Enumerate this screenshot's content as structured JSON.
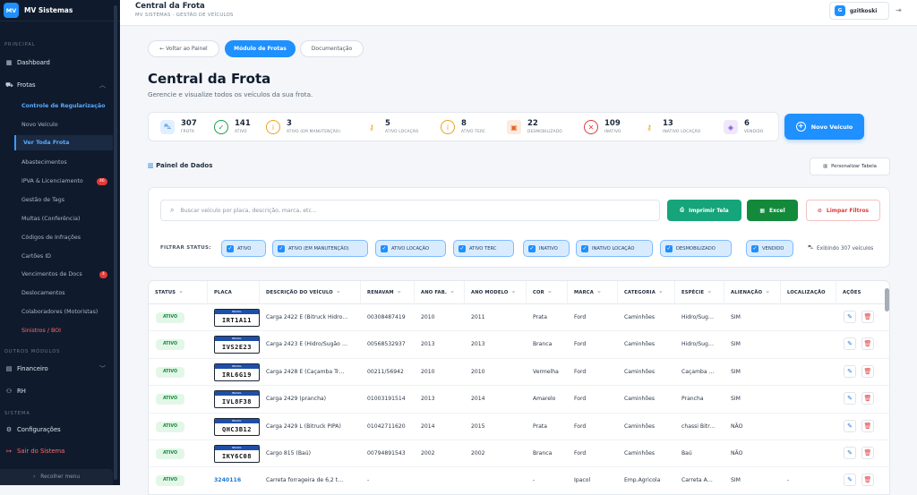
{
  "app": {
    "logo": "MV",
    "name": "MV Sistemas"
  },
  "sidebar": {
    "sections": {
      "principal": "PRINCIPAL",
      "outros": "OUTROS MÓDULOS",
      "sistema": "SISTEMA"
    },
    "dashboard": "Dashboard",
    "frotas": "Frotas",
    "frotas_items": [
      {
        "label": "Controle de Regularização"
      },
      {
        "label": "Novo Veículo"
      },
      {
        "label": "Ver Toda Frota"
      },
      {
        "label": "Abastecimentos"
      },
      {
        "label": "IPVA & Licenciamento",
        "badge": "46"
      },
      {
        "label": "Gestão de Tags"
      },
      {
        "label": "Multas (Conferência)"
      },
      {
        "label": "Códigos de Infrações"
      },
      {
        "label": "Cartões ID"
      },
      {
        "label": "Vencimentos de Docs",
        "badge": "4"
      },
      {
        "label": "Deslocamentos"
      },
      {
        "label": "Colaboradores (Motoristas)"
      },
      {
        "label": "Sinistros / BOI"
      }
    ],
    "financeiro": "Financeiro",
    "rh": "RH",
    "configuracoes": "Configurações",
    "sair": "Sair do Sistema",
    "recolher": "Recolher menu"
  },
  "topbar": {
    "title": "Central da Frota",
    "subtitle": "MV SISTEMAS - GESTÃO DE VEÍCULOS",
    "user_initial": "G",
    "user": "gzitkoski"
  },
  "tabs": {
    "back": "← Voltar ao Painel",
    "module": "Módulo de Frotas",
    "docs": "Documentação"
  },
  "page": {
    "title": "Central da Frota",
    "subtitle": "Gerencie e visualize todos os veículos da sua frota."
  },
  "stats": [
    {
      "value": "307",
      "label": "FROTA"
    },
    {
      "value": "141",
      "label": "ATIVO"
    },
    {
      "value": "3",
      "label": "ATIVO (EM MANUTENÇÃO)"
    },
    {
      "value": "5",
      "label": "ATIVO LOCAÇÃO"
    },
    {
      "value": "8",
      "label": "ATIVO TERC"
    },
    {
      "value": "22",
      "label": "DESMOBILIZADO"
    },
    {
      "value": "109",
      "label": "INATIVO"
    },
    {
      "value": "13",
      "label": "INATIVO LOCAÇÃO"
    },
    {
      "value": "6",
      "label": "VENDIDO"
    }
  ],
  "new_vehicle": "Novo Veículo",
  "panel": {
    "title": "Painel de Dados",
    "customize": "Personalizar Tabela"
  },
  "filters": {
    "search_placeholder": "Buscar veículo por placa, descrição, marca, etc...",
    "print": "Imprimir Tela",
    "excel": "Excel",
    "clear": "Limpar Filtros",
    "status_label": "FILTRAR STATUS:",
    "chips": [
      "ATIVO",
      "ATIVO (EM MANUTENÇÃO)",
      "ATIVO LOCAÇÃO",
      "ATIVO TERC",
      "INATIVO",
      "INATIVO LOCAÇÃO",
      "DESMOBILIZADO",
      "VENDIDO"
    ],
    "showing": "Exibindo 307 veículos"
  },
  "table": {
    "headers": [
      "STATUS",
      "PLACA",
      "DESCRIÇÃO DO VEÍCULO",
      "RENAVAM",
      "ANO FAB.",
      "ANO MODELO",
      "COR",
      "MARCA",
      "CATEGORIA",
      "ESPÉCIE",
      "ALIENAÇÃO",
      "LOCALIZAÇÃO",
      "AÇÕES"
    ],
    "plate_top": "BRASIL",
    "rows": [
      {
        "status": "ATIVO",
        "placa": "IRT1A11",
        "descricao": "Carga 2422 E (Bitruck Hidro…",
        "renavam": "00308487419",
        "fab": "2010",
        "modelo": "2011",
        "cor": "Prata",
        "marca": "Ford",
        "categoria": "Caminhões",
        "especie": "Hidro/Sug…",
        "alienacao": "SIM",
        "localizacao": ""
      },
      {
        "status": "ATIVO",
        "placa": "IVS2E23",
        "descricao": "Carga 2423 E (Hidro/Sugão …",
        "renavam": "00568532937",
        "fab": "2013",
        "modelo": "2013",
        "cor": "Branca",
        "marca": "Ford",
        "categoria": "Caminhões",
        "especie": "Hidro/Sug…",
        "alienacao": "SIM",
        "localizacao": ""
      },
      {
        "status": "ATIVO",
        "placa": "IRL6G19",
        "descricao": "Carga 2428 E (Caçamba Tr…",
        "renavam": "00211/56942",
        "fab": "2010",
        "modelo": "2010",
        "cor": "Vermelha",
        "marca": "Ford",
        "categoria": "Caminhões",
        "especie": "Caçamba …",
        "alienacao": "SIM",
        "localizacao": ""
      },
      {
        "status": "ATIVO",
        "placa": "IVL8F38",
        "descricao": "Carga 2429 (prancha)",
        "renavam": "01003191514",
        "fab": "2013",
        "modelo": "2014",
        "cor": "Amarelo",
        "marca": "Ford",
        "categoria": "Caminhões",
        "especie": "Prancha",
        "alienacao": "SIM",
        "localizacao": ""
      },
      {
        "status": "ATIVO",
        "placa": "QHC3B12",
        "descricao": "Carga 2429 L (Bitruck PIPA)",
        "renavam": "01042711620",
        "fab": "2014",
        "modelo": "2015",
        "cor": "Prata",
        "marca": "Ford",
        "categoria": "Caminhões",
        "especie": "chassi Bitr…",
        "alienacao": "NÃO",
        "localizacao": ""
      },
      {
        "status": "ATIVO",
        "placa": "IKY6C08",
        "descricao": "Cargo 815 (Baú)",
        "renavam": "00794891543",
        "fab": "2002",
        "modelo": "2002",
        "cor": "Branca",
        "marca": "Ford",
        "categoria": "Caminhões",
        "especie": "Baú",
        "alienacao": "NÃO",
        "localizacao": ""
      },
      {
        "status": "ATIVO",
        "placa": "3240116",
        "descricao": "Carreta forrageira de 6,2 t…",
        "renavam": "-",
        "fab": "",
        "modelo": "",
        "cor": "-",
        "marca": "Ipacol",
        "categoria": "Emp.Agricola",
        "especie": "Carreta A…",
        "alienacao": "SIM",
        "localizacao": "-"
      }
    ]
  },
  "colors": {
    "accent": "#1e90ff",
    "sidebar": "#0f1b2d",
    "success": "#16a47a",
    "danger": "#e03a3a"
  }
}
